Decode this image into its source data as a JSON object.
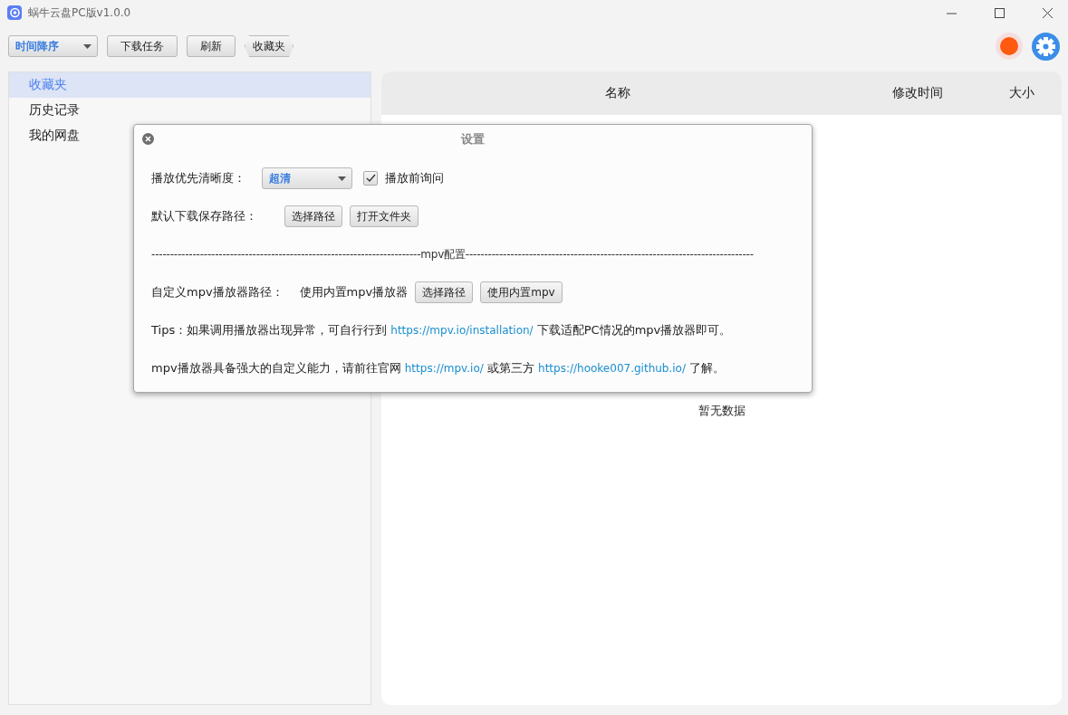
{
  "window": {
    "title": "蜗牛云盘PC版v1.0.0"
  },
  "toolbar": {
    "sort": {
      "value": "时间降序"
    },
    "buttons": [
      "下载任务",
      "刷新"
    ],
    "breadcrumb": [
      "收藏夹"
    ]
  },
  "sidebar": {
    "items": [
      {
        "label": "收藏夹",
        "selected": true
      },
      {
        "label": "历史记录",
        "selected": false
      },
      {
        "label": "我的网盘",
        "selected": false
      }
    ]
  },
  "table": {
    "columns": [
      "名称",
      "修改时间",
      "大小"
    ],
    "empty_text": "暂无数据"
  },
  "settings_dialog": {
    "title": "设置",
    "quality": {
      "label": "播放优先清晰度：",
      "value": "超清",
      "ask": {
        "label": "播放前询问",
        "checked": true
      }
    },
    "download_path": {
      "label": "默认下载保存路径：",
      "buttons": [
        "选择路径",
        "打开文件夹"
      ]
    },
    "separator": "------------------------------------------------------------------------mpv配置-----------------------------------------------------------------------------",
    "mpv_path": {
      "label": "自定义mpv播放器路径：",
      "value": "使用内置mpv播放器",
      "buttons": [
        "选择路径",
        "使用内置mpv"
      ]
    },
    "tips": [
      {
        "parts": [
          {
            "text": "Tips：如果调用播放器出现异常，可自行行到 "
          },
          {
            "text": "https://mpv.io/installation/",
            "link": true
          },
          {
            "text": " 下载适配PC情况的mpv播放器即可。"
          }
        ]
      },
      {
        "parts": [
          {
            "text": "mpv播放器具备强大的自定义能力，请前往官网 "
          },
          {
            "text": "https://mpv.io/",
            "link": true
          },
          {
            "text": " 或第三方 "
          },
          {
            "text": "https://hooke007.github.io/",
            "link": true
          },
          {
            "text": " 了解。"
          }
        ]
      }
    ]
  }
}
